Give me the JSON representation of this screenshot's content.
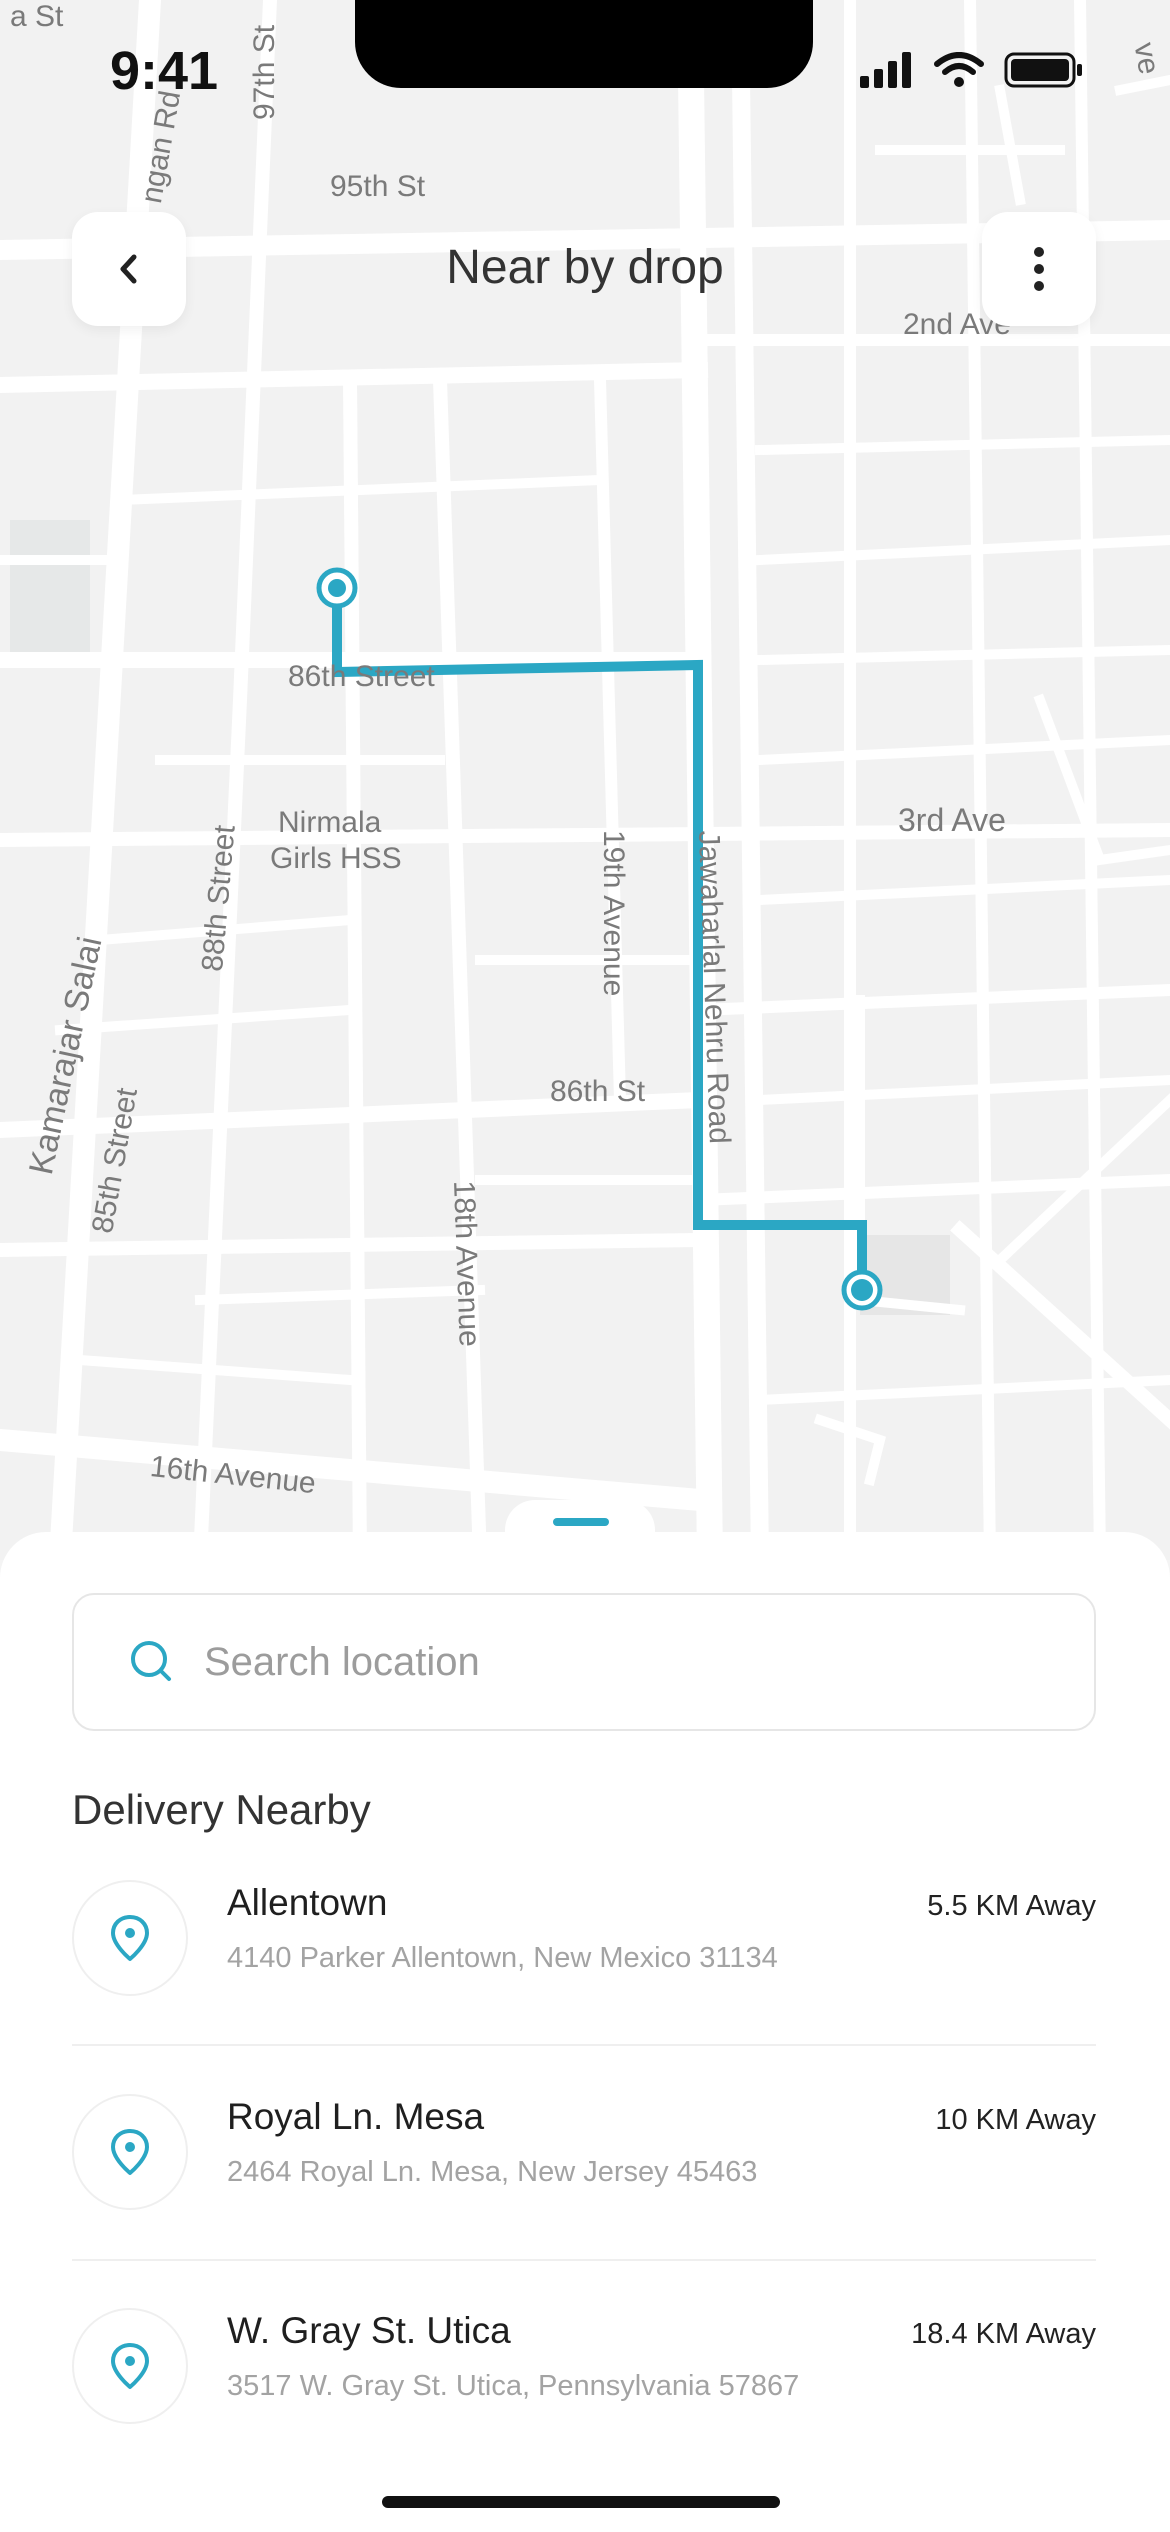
{
  "status_bar": {
    "time": "9:41"
  },
  "header": {
    "title": "Near by drop"
  },
  "map": {
    "route_color": "#2ba7c4",
    "street_labels": [
      "a St",
      "97th St",
      "ngan Rd",
      "95th St",
      "2nd Ave",
      "86th Street",
      "Nirmala",
      "Girls HSS",
      "3rd Ave",
      "19th Avenue",
      "88th Street",
      "Jawaharlal Nehru Road",
      "Kamarajar Salai",
      "85th Street",
      "86th St",
      "18th Avenue",
      "16th Avenue",
      "ve"
    ]
  },
  "search": {
    "placeholder": "Search location"
  },
  "deliveries": {
    "title": "Delivery Nearby",
    "items": [
      {
        "name": "Allentown",
        "address": "4140 Parker Allentown, New Mexico 31134",
        "distance": "5.5 KM Away"
      },
      {
        "name": "Royal Ln. Mesa",
        "address": "2464 Royal Ln. Mesa, New Jersey 45463",
        "distance": "10 KM Away"
      },
      {
        "name": "W. Gray St. Utica",
        "address": "3517 W. Gray St. Utica, Pennsylvania 57867",
        "distance": "18.4 KM Away"
      }
    ]
  }
}
